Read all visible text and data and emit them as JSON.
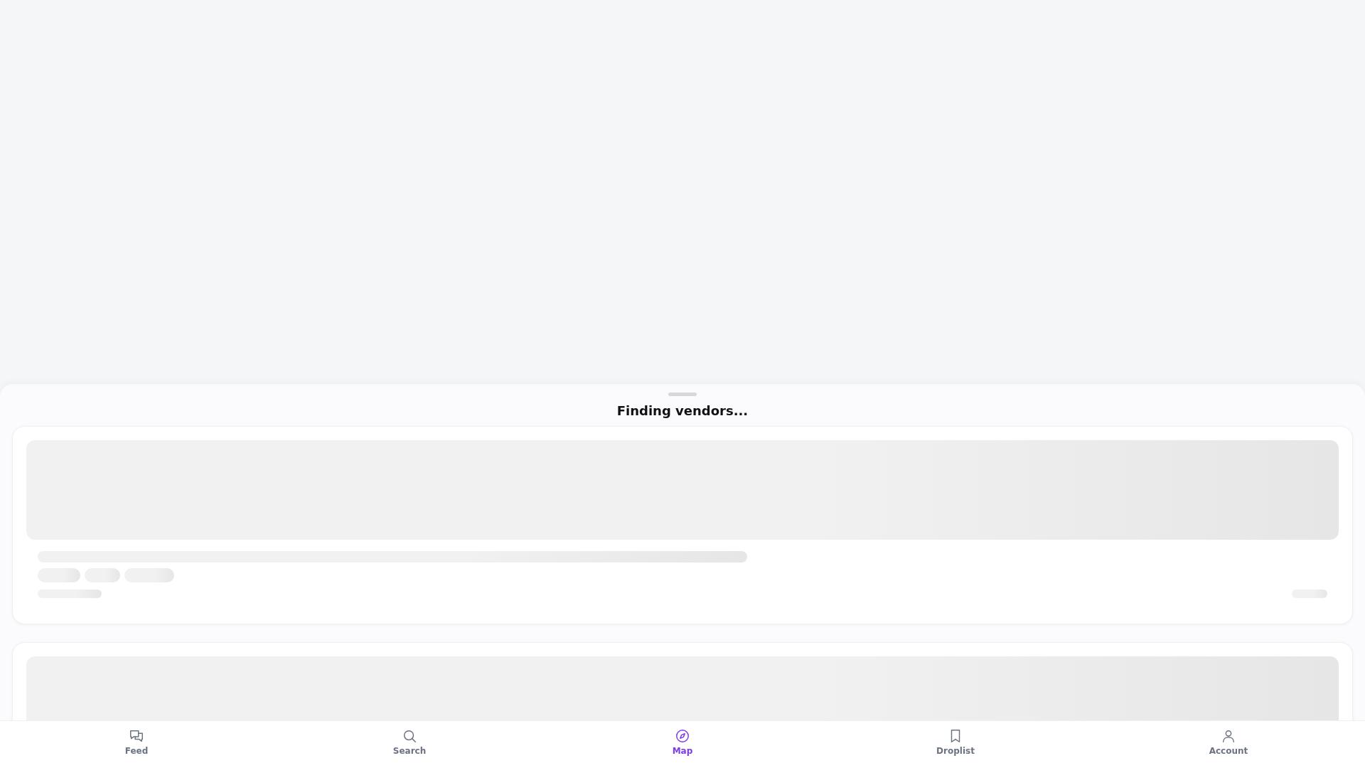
{
  "sheet": {
    "title": "Finding vendors..."
  },
  "placeholder_cards": [
    {
      "kind": "card"
    },
    {
      "kind": "card_top"
    }
  ],
  "nav": [
    {
      "label": "Feed",
      "selected": false
    },
    {
      "label": "Search",
      "selected": false
    },
    {
      "label": "Map",
      "selected": true
    },
    {
      "label": "Droplist",
      "selected": false
    },
    {
      "label": "Account",
      "selected": false
    }
  ]
}
